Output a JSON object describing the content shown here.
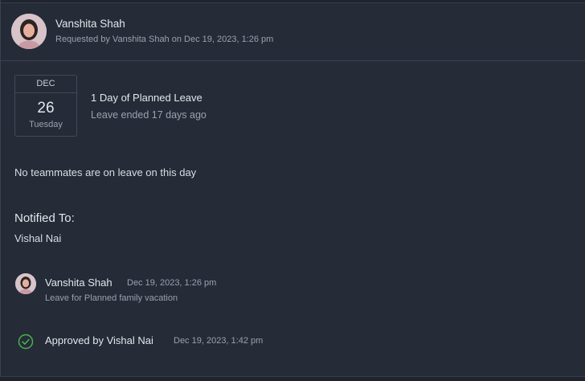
{
  "request": {
    "employee_name": "Vanshita Shah",
    "requested_line": "Requested by Vanshita Shah on Dec 19, 2023, 1:26 pm"
  },
  "leave": {
    "month": "DEC",
    "day": "26",
    "weekday": "Tuesday",
    "title": "1 Day of Planned Leave",
    "status": "Leave ended 17 days ago"
  },
  "teammates_text": "No teammates are on leave on this day",
  "notified": {
    "heading": "Notified To:",
    "name": "Vishal Nai"
  },
  "activity": {
    "comment": {
      "name": "Vanshita Shah",
      "time": "Dec 19, 2023, 1:26 pm",
      "note": "Leave for Planned family vacation"
    },
    "approval": {
      "text": "Approved by Vishal Nai",
      "time": "Dec 19, 2023, 1:42 pm",
      "icon": "check-circle-icon"
    }
  },
  "colors": {
    "background": "#252b37",
    "approved_green": "#4caf50"
  }
}
